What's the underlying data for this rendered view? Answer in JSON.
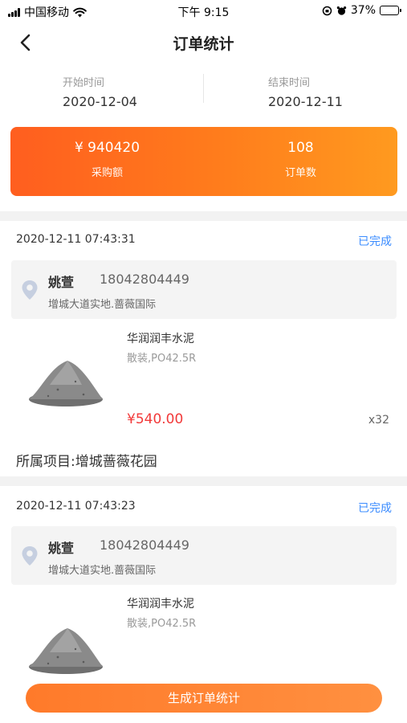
{
  "status_bar": {
    "carrier": "中国移动",
    "time": "下午 9:15",
    "battery_pct": "37%",
    "battery_level": 0.37,
    "icons": [
      "signal-icon",
      "wifi-icon",
      "orientation-lock-icon",
      "alarm-icon",
      "battery-icon"
    ]
  },
  "nav": {
    "title": "订单统计",
    "back_icon": "chevron-left-icon"
  },
  "date_range": {
    "start_label": "开始时间",
    "start_value": "2020-12-04",
    "end_label": "结束时间",
    "end_value": "2020-12-11"
  },
  "stats": {
    "amount_value": "¥ 940420",
    "amount_label": "采购额",
    "count_value": "108",
    "count_label": "订单数"
  },
  "orders": [
    {
      "time": "2020-12-11 07:43:31",
      "status": "已完成",
      "name": "姚萱",
      "phone": "18042804449",
      "address": "增城大道实地.蔷薇国际",
      "product_name": "华润润丰水泥",
      "product_spec": "散装,PO42.5R",
      "price": "¥540.00",
      "qty": "x32",
      "project": "所属项目:增城蔷薇花园"
    },
    {
      "time": "2020-12-11 07:43:23",
      "status": "已完成",
      "name": "姚萱",
      "phone": "18042804449",
      "address": "增城大道实地.蔷薇国际",
      "product_name": "华润润丰水泥",
      "product_spec": "散装,PO42.5R"
    }
  ],
  "footer": {
    "generate_label": "生成订单统计"
  },
  "colors": {
    "accent_orange": "#ff7a1c",
    "status_blue": "#3b8cff",
    "price_red": "#f23a3a"
  }
}
